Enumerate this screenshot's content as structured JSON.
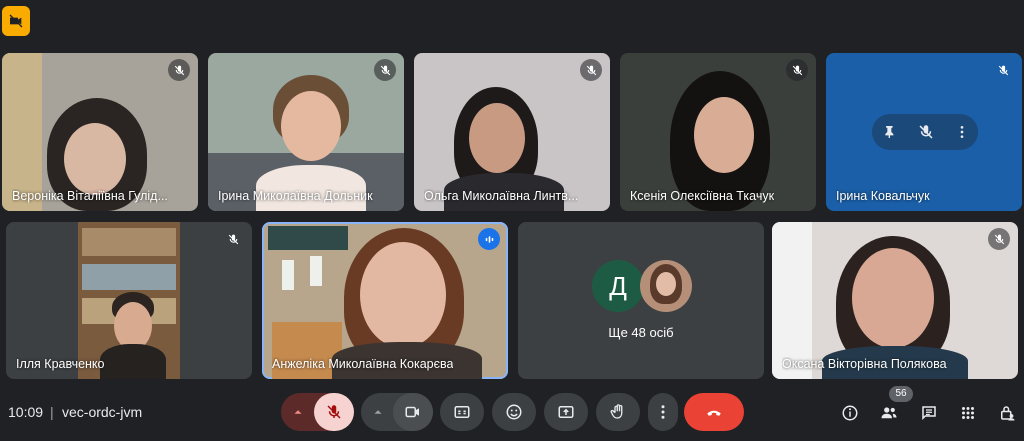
{
  "top_badge_icon": "camera-off-icon",
  "tiles": [
    {
      "name": "Вероніка Віталіївна Гулід..."
    },
    {
      "name": "Ірина Миколаївна Дольник"
    },
    {
      "name": "Ольга Миколаївна Линтв..."
    },
    {
      "name": "Ксенія Олексіївна Ткачук"
    },
    {
      "name": "Ірина Ковальчук"
    },
    {
      "name": "Ілля Кравченко"
    },
    {
      "name": "Анжеліка Миколаївна Кокарєва"
    },
    {
      "name": "Ще 48 осіб",
      "avatar_letter": "Д"
    },
    {
      "name": "Оксана Вікторівна Полякова"
    }
  ],
  "footer": {
    "time": "10:09",
    "meeting_code": "vec-ordc-jvm",
    "participants_count": "56"
  },
  "colors": {
    "background": "#202124",
    "tile": "#3c4043",
    "accent_yellow": "#f9ab00",
    "mic_active_bg": "#f6d3d1",
    "end_call": "#ea4335",
    "avatar_green": "#1e5b44",
    "blue_tile": "#1a5fa8"
  }
}
